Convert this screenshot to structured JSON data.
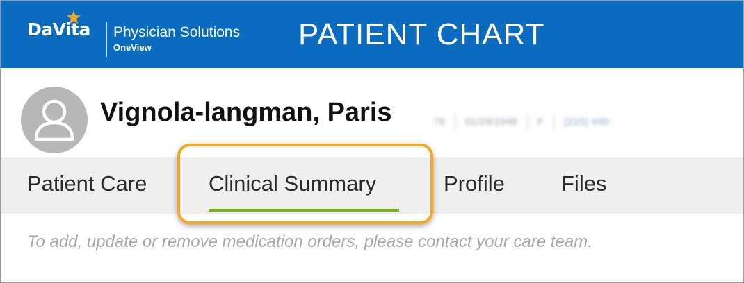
{
  "header": {
    "logo_brand": "DaVita",
    "logo_product": "Physician Solutions",
    "logo_sub": "OneView",
    "title": "PATIENT CHART",
    "colors": {
      "bar": "#0b6cbf",
      "star": "#f5a623"
    }
  },
  "patient": {
    "name": "Vignola-langman, Paris",
    "redacted": [
      "76",
      "01/29/1948",
      "F",
      "(215) 440-"
    ]
  },
  "tabs": [
    {
      "label": "Patient Care",
      "selected": false
    },
    {
      "label": "Clinical Summary",
      "selected": true
    },
    {
      "label": "Profile",
      "selected": false
    },
    {
      "label": "Files",
      "selected": false
    }
  ],
  "notice": "To add, update or remove medication orders, please contact your care team.",
  "accents": {
    "highlight": "#f5a623",
    "tab_underline": "#7cb01c"
  }
}
